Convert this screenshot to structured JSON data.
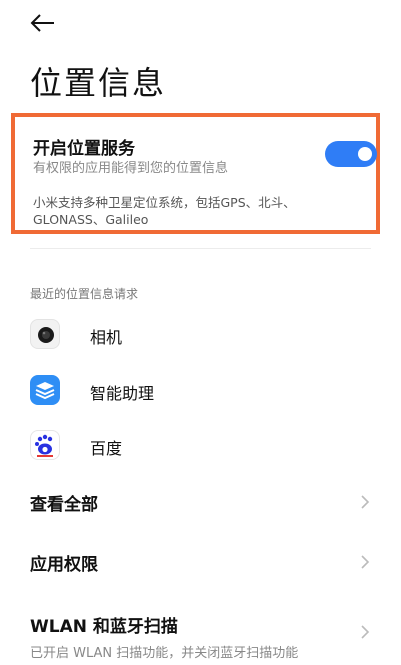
{
  "header": {
    "back_icon": "arrow-left-icon",
    "title": "位置信息"
  },
  "location_service": {
    "title": "开启位置服务",
    "subtitle": "有权限的应用能得到您的位置信息",
    "note": "小米支持多种卫星定位系统，包括GPS、北斗、GLONASS、Galileo",
    "enabled": true,
    "accent": "#2f7df6",
    "highlight": "#f06a35"
  },
  "recent": {
    "label": "最近的位置信息请求",
    "apps": [
      {
        "name": "相机",
        "icon": "camera-icon"
      },
      {
        "name": "智能助理",
        "icon": "smart-assistant-icon"
      },
      {
        "name": "百度",
        "icon": "baidu-icon"
      }
    ]
  },
  "nav": {
    "view_all": "查看全部",
    "app_permissions": "应用权限",
    "wlan_bt_title": "WLAN 和蓝牙扫描",
    "wlan_bt_sub": "已开启 WLAN 扫描功能，并关闭蓝牙扫描功能"
  }
}
